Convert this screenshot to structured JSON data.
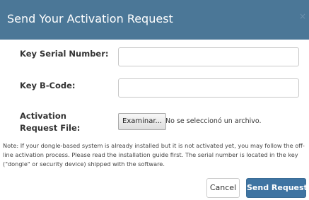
{
  "dialog": {
    "title": "Send Your Activation Request",
    "close_symbol": "×"
  },
  "form": {
    "serial_label": "Key Serial Number:",
    "serial_value": "",
    "bcode_label": "Key B-Code:",
    "bcode_value": "",
    "file_label": "Activation Request File:",
    "file_button_label": "Examinar...",
    "file_status": "No se seleccionó un archivo."
  },
  "note": "Note: If your dongle-based system is already installed but it is not activated yet, you may follow the off-line activation process. Please read the installation guide first. The serial number is located in the key (\"dongle\" or security device) shipped with the software.",
  "footer": {
    "cancel_label": "Cancel",
    "send_label": "Send Request"
  },
  "colors": {
    "header_bg": "#4b7797",
    "primary_button": "#3f74a2"
  }
}
